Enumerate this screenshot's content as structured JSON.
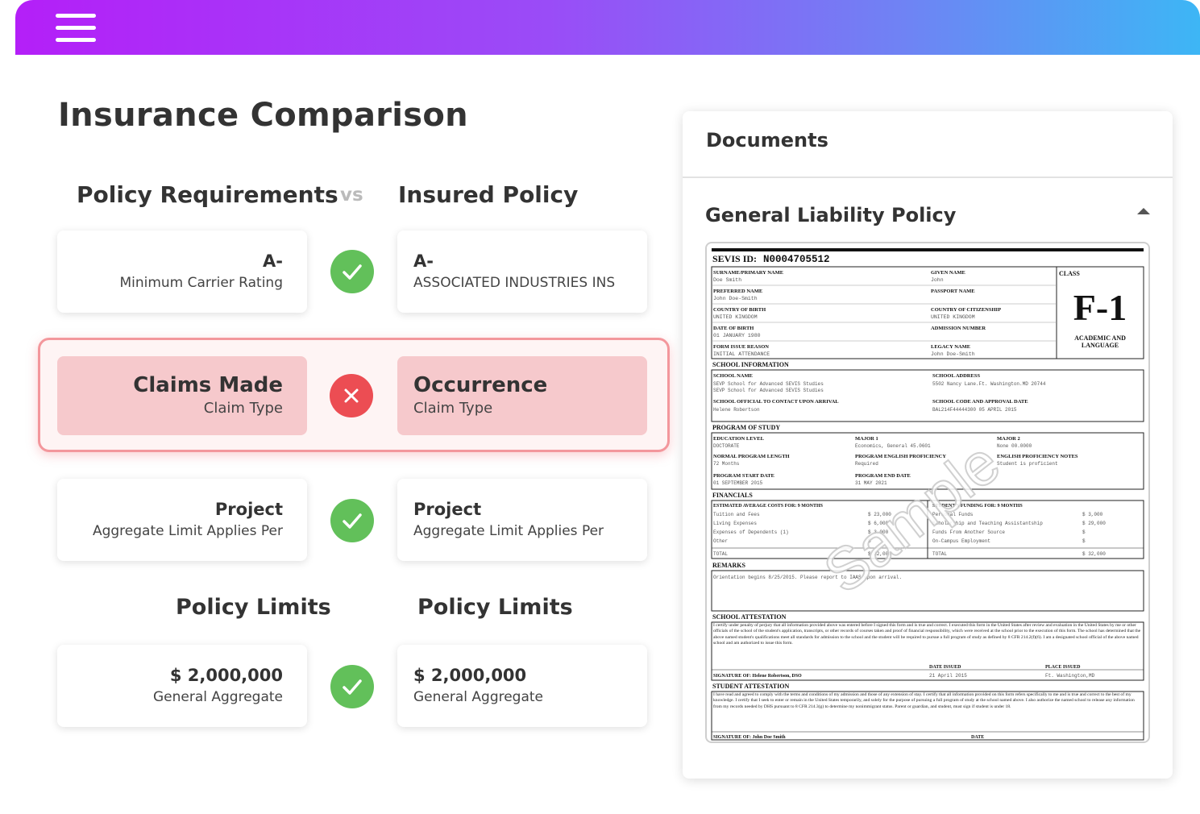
{
  "page": {
    "title": "Insurance Comparison"
  },
  "columns": {
    "left": "Policy Requirements",
    "vs": "vs",
    "right": "Insured Policy"
  },
  "rows": [
    {
      "left_value": "A-",
      "left_label": "Minimum Carrier Rating",
      "right_value": "A-",
      "right_label": "ASSOCIATED INDUSTRIES INS",
      "status": "match"
    },
    {
      "left_value": "Claims Made",
      "left_label": "Claim Type",
      "right_value": "Occurrence",
      "right_label": "Claim Type",
      "status": "mismatch"
    },
    {
      "left_value": "Project",
      "left_label": "Aggregate Limit Applies Per",
      "right_value": "Project",
      "right_label": "Aggregate Limit Applies Per",
      "status": "match"
    }
  ],
  "limits": {
    "left_heading": "Policy Limits",
    "right_heading": "Policy Limits",
    "row": {
      "left_value": "$ 2,000,000",
      "left_label": "General Aggregate",
      "right_value": "$ 2,000,000",
      "right_label": "General Aggregate",
      "status": "match"
    }
  },
  "documents": {
    "title": "Documents",
    "item": "General Liability Policy",
    "preview": {
      "sevis_label": "SEVIS ID:",
      "sevis_id": "N0004705512",
      "class_label": "CLASS",
      "class_value": "F-1",
      "class_sub1": "ACADEMIC AND",
      "class_sub2": "LANGUAGE",
      "watermark": "Sample",
      "fields": [
        {
          "label": "SURNAME/PRIMARY NAME",
          "value": "Doe Smith"
        },
        {
          "label": "GIVEN NAME",
          "value": "John"
        },
        {
          "label": "PREFERRED NAME",
          "value": "John Doe-Smith"
        },
        {
          "label": "PASSPORT NAME",
          "value": ""
        },
        {
          "label": "COUNTRY OF BIRTH",
          "value": "UNITED KINGDOM"
        },
        {
          "label": "COUNTRY OF CITIZENSHIP",
          "value": "UNITED KINGDOM"
        },
        {
          "label": "DATE OF BIRTH",
          "value": "01 JANUARY 1980"
        },
        {
          "label": "ADMISSION NUMBER",
          "value": ""
        },
        {
          "label": "FORM ISSUE REASON",
          "value": "INITIAL ATTENDANCE"
        },
        {
          "label": "LEGACY NAME",
          "value": "John Doe-Smith"
        }
      ],
      "sections": {
        "school": "SCHOOL INFORMATION",
        "program": "PROGRAM OF STUDY",
        "financials": "FINANCIALS",
        "remarks": "REMARKS",
        "school_attest": "SCHOOL ATTESTATION",
        "student_attest": "STUDENT ATTESTATION"
      },
      "school_fields": [
        {
          "label": "SCHOOL NAME",
          "value": "SEVP School for Advanced SEVIS Studies"
        },
        {
          "label": "SCHOOL ADDRESS",
          "value": "5502 Nancy Lane.Ft. Washington.MD 20744"
        },
        {
          "label": "SCHOOL OFFICIAL TO CONTACT UPON ARRIVAL",
          "value": "Helene Robertson"
        },
        {
          "label": "SCHOOL CODE AND APPROVAL DATE",
          "value": "BAL214F44444300 05 APRIL 2015"
        }
      ],
      "program_fields": [
        {
          "label": "EDUCATION LEVEL",
          "value": "DOCTORATE"
        },
        {
          "label": "MAJOR 1",
          "value": "Economics, General 45.0601"
        },
        {
          "label": "MAJOR 2",
          "value": "None 00.0000"
        },
        {
          "label": "NORMAL PROGRAM LENGTH",
          "value": "72 Months"
        },
        {
          "label": "PROGRAM ENGLISH PROFICIENCY",
          "value": "Required"
        },
        {
          "label": "ENGLISH PROFICIENCY NOTES",
          "value": "Student is proficient"
        },
        {
          "label": "PROGRAM START DATE",
          "value": "01 SEPTEMBER 2015"
        },
        {
          "label": "PROGRAM END DATE",
          "value": "31 MAY 2021"
        }
      ],
      "costs_label": "ESTIMATED AVERAGE COSTS FOR: 9 MONTHS",
      "funding_label": "STUDENT'S FUNDING FOR: 9 MONTHS",
      "costs": [
        {
          "item": "Tuition and Fees",
          "amount": "$ 23,000"
        },
        {
          "item": "Living Expenses",
          "amount": "$ 6,000"
        },
        {
          "item": "Expenses of Dependents (1)",
          "amount": "$ 3,000"
        },
        {
          "item": "Other",
          "amount": "$"
        },
        {
          "item": "TOTAL",
          "amount": "$ 32,000"
        }
      ],
      "funding": [
        {
          "item": "Personal Funds",
          "amount": "$ 3,000"
        },
        {
          "item": "Scholarship and Teaching Assistantship",
          "amount": "$ 29,000"
        },
        {
          "item": "Funds From Another Source",
          "amount": "$"
        },
        {
          "item": "On-Campus Employment",
          "amount": "$"
        },
        {
          "item": "TOTAL",
          "amount": "$ 32,000"
        }
      ],
      "remarks_text": "Orientation begins 8/25/2015. Please report to IAAS upon arrival.",
      "school_attest_text": "I certify under penalty of perjury that all information provided above was entered before I signed this form and is true and correct. I executed this form in the United States after review and evaluation in the United States by me or other officials of the school of the student's application, transcripts, or other records of courses taken and proof of financial responsibility, which were received at the school prior to the execution of this form. The school has determined that the above named student's qualifications meet all standards for admission to the school and the student will be required to pursue a full program of study as defined by 8 CFR 214.2(f)(6). I am a designated school official of the above named school and am authorized to issue this form.",
      "dso_signature": "SIGNATURE OF: Helene Robertson, DSO",
      "date_issued_label": "DATE ISSUED",
      "date_issued": "21 April 2015",
      "place_issued_label": "PLACE ISSUED",
      "place_issued": "Ft. Washington,MD",
      "student_attest_text": "I have read and agreed to comply with the terms and conditions of my admission and those of any extension of stay. I certify that all information provided on this form refers specifically to me and is true and correct to the best of my knowledge. I certify that I seek to enter or remain in the United States temporarily, and solely for the purpose of pursuing a full program of study at the school named above. I also authorize the named school to release any information from my records needed by DHS pursuant to 8 CFR 214.3(g) to determine my nonimmigrant status. Parent or guardian, and student, must sign if student is under 18.",
      "student_signature": "SIGNATURE OF: John Doe Smith",
      "date_label": "DATE"
    }
  },
  "colors": {
    "match": "#62c05a",
    "mismatch": "#ec4d53",
    "mismatch_card": "#f6c9cc",
    "mismatch_border": "#f3979c"
  }
}
